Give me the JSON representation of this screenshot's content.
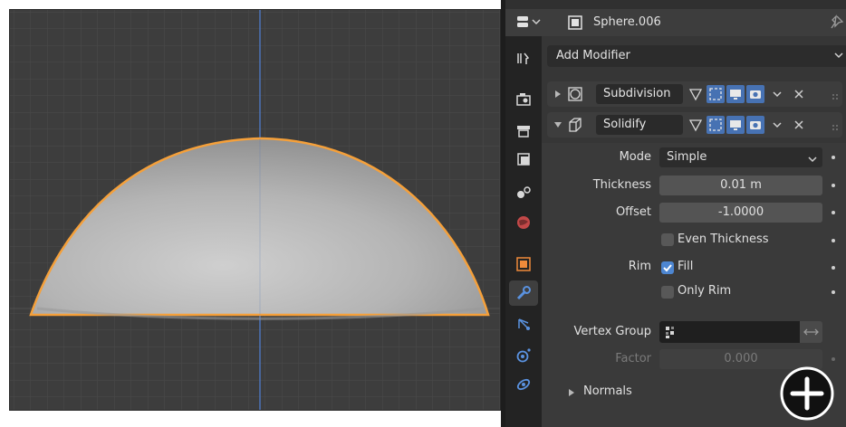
{
  "header": {
    "object_name": "Sphere.006"
  },
  "add_modifier": {
    "label": "Add Modifier"
  },
  "modifiers": [
    {
      "name": "Subdivision",
      "expanded": false
    },
    {
      "name": "Solidify",
      "expanded": true
    }
  ],
  "solidify": {
    "mode_label": "Mode",
    "mode_value": "Simple",
    "thickness_label": "Thickness",
    "thickness_value": "0.01 m",
    "offset_label": "Offset",
    "offset_value": "-1.0000",
    "even_thickness_label": "Even Thickness",
    "even_thickness_checked": false,
    "rim_label": "Rim",
    "fill_label": "Fill",
    "fill_checked": true,
    "only_rim_label": "Only Rim",
    "only_rim_checked": false,
    "vertex_group_label": "Vertex Group",
    "vertex_group_value": "",
    "factor_label": "Factor",
    "factor_value": "0.000",
    "normals_label": "Normals"
  },
  "colors": {
    "accent_blue": "#4772b3",
    "selection_outline": "#f5a03a",
    "checkbox_checked": "#4d86d1"
  },
  "icons": {
    "tabs": [
      "tool-icon",
      "render-icon",
      "output-icon",
      "view-layer-icon",
      "scene-icon",
      "world-icon",
      "object-icon",
      "modifier-icon",
      "particles-icon",
      "physics-icon",
      "constraints-icon"
    ],
    "overlay": "plus-circle-icon"
  }
}
